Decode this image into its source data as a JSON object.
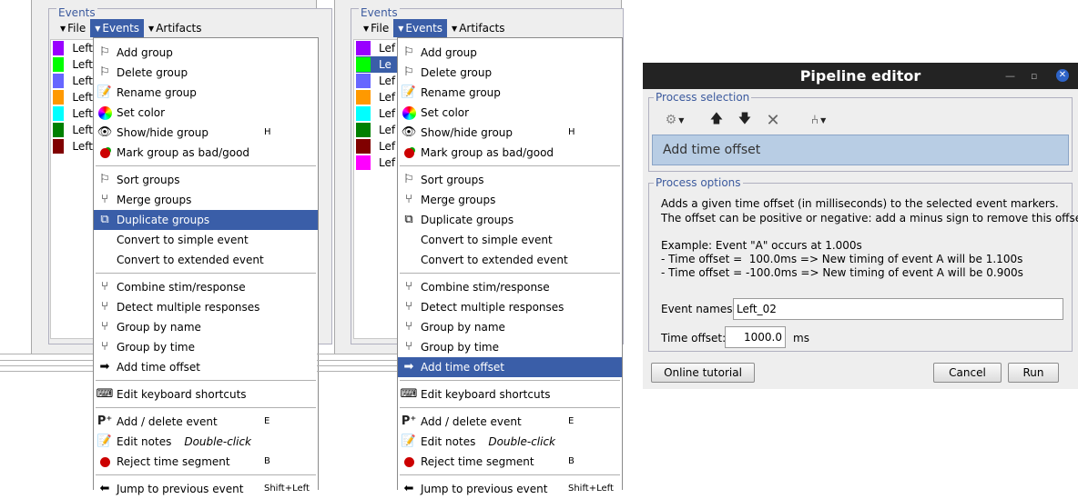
{
  "left_panel": {
    "group_label": "Events",
    "menubar": {
      "file": "File",
      "events": "Events",
      "artifacts": "Artifacts"
    },
    "event_rows": [
      {
        "label": "Left",
        "color": "#9900ff"
      },
      {
        "label": "Left",
        "color": "#00ff00"
      },
      {
        "label": "Left",
        "color": "#6666ff"
      },
      {
        "label": "Left",
        "color": "#ff9900"
      },
      {
        "label": "Left",
        "color": "#00ffff"
      },
      {
        "label": "Left",
        "color": "#008000"
      },
      {
        "label": "Left",
        "color": "#800000"
      }
    ]
  },
  "right_panel": {
    "group_label": "Events",
    "menubar": {
      "file": "File",
      "events": "Events",
      "artifacts": "Artifacts"
    },
    "event_rows": [
      {
        "label": "Lef",
        "color": "#9900ff"
      },
      {
        "label": "Le",
        "color": "#00ff00"
      },
      {
        "label": "Lef",
        "color": "#6666ff"
      },
      {
        "label": "Lef",
        "color": "#ff9900"
      },
      {
        "label": "Lef",
        "color": "#00ffff"
      },
      {
        "label": "Lef",
        "color": "#008000"
      },
      {
        "label": "Lef",
        "color": "#800000"
      },
      {
        "label": "Lef",
        "color": "#ff00ff"
      }
    ]
  },
  "events_menu": {
    "add_group": "Add group",
    "delete_group": "Delete group",
    "rename_group": "Rename group",
    "set_color": "Set color",
    "show_hide_group": "Show/hide group",
    "show_hide_shortcut": "H",
    "mark_bad_good": "Mark group as bad/good",
    "sort_groups": "Sort groups",
    "merge_groups": "Merge groups",
    "duplicate_groups": "Duplicate groups",
    "convert_simple": "Convert to simple event",
    "convert_extended": "Convert to extended event",
    "combine_stim": "Combine stim/response",
    "detect_multiple": "Detect multiple responses",
    "group_by_name": "Group by name",
    "group_by_time": "Group by time",
    "add_time_offset": "Add time offset",
    "edit_shortcuts": "Edit keyboard shortcuts",
    "add_delete_event": "Add / delete event",
    "add_delete_shortcut": "E",
    "edit_notes": "Edit notes",
    "edit_notes_hint": "Double-click",
    "reject_segment": "Reject time segment",
    "reject_shortcut": "B",
    "jump_previous": "Jump to previous event",
    "jump_previous_shortcut": "Shift+Left"
  },
  "pipeline_editor": {
    "title": "Pipeline editor",
    "process_selection_label": "Process selection",
    "selected_process": "Add time offset",
    "process_options_label": "Process options",
    "description_line1": "Adds a given time offset (in milliseconds) to the selected event markers.",
    "description_line2": "The offset can be positive or negative: add a minus sign to remove this offset.",
    "example_line1": "Example: Event \"A\" occurs at 1.000s",
    "example_line2": "- Time offset =  100.0ms => New timing of event A will be 1.100s",
    "example_line3": "- Time offset = -100.0ms => New timing of event A will be 0.900s",
    "event_names_label": "Event names:",
    "event_names_value": "Left_02",
    "time_offset_label": "Time offset:",
    "time_offset_value": "1000.0",
    "time_offset_unit": "ms",
    "online_tutorial": "Online tutorial",
    "cancel": "Cancel",
    "run": "Run"
  }
}
